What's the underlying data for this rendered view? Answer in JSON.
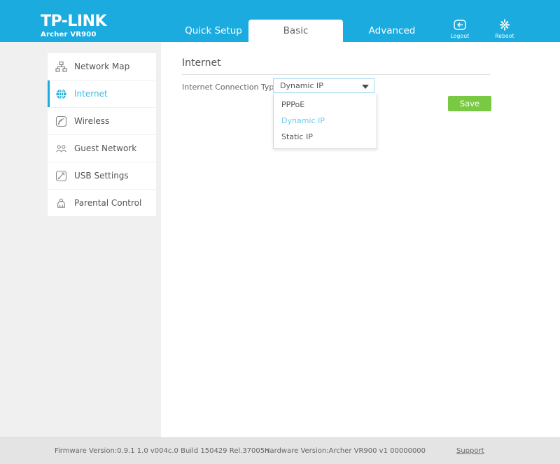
{
  "brand": {
    "name": "TP-LINK",
    "model": "Archer VR900"
  },
  "header": {
    "tabs": [
      {
        "label": "Quick Setup",
        "active": false
      },
      {
        "label": "Basic",
        "active": true
      },
      {
        "label": "Advanced",
        "active": false
      }
    ],
    "actions": [
      {
        "label": "Logout",
        "icon": "logout-icon"
      },
      {
        "label": "Reboot",
        "icon": "reboot-icon"
      }
    ],
    "accent_color": "#1cabdf"
  },
  "sidebar": {
    "items": [
      {
        "label": "Network Map",
        "icon": "network-map-icon",
        "active": false
      },
      {
        "label": "Internet",
        "icon": "globe-icon",
        "active": true
      },
      {
        "label": "Wireless",
        "icon": "wireless-signal-icon",
        "active": false
      },
      {
        "label": "Guest Network",
        "icon": "guest-network-icon",
        "active": false
      },
      {
        "label": "USB Settings",
        "icon": "usb-icon",
        "active": false
      },
      {
        "label": "Parental Control",
        "icon": "parental-control-icon",
        "active": false
      }
    ],
    "active_color": "#3fb8e6"
  },
  "main": {
    "section_title": "Internet",
    "connection_type": {
      "label": "Internet Connection Type:",
      "value": "Dynamic IP",
      "expanded": true,
      "options": [
        {
          "label": "PPPoE",
          "selected": false
        },
        {
          "label": "Dynamic IP",
          "selected": true
        },
        {
          "label": "Static IP",
          "selected": false
        }
      ]
    },
    "save_label": "Save",
    "save_color": "#7ac943"
  },
  "footer": {
    "firmware_version": "Firmware Version:0.9.1 1.0 v004c.0 Build 150429 Rel.37005n",
    "hardware_version": "Hardware Version:Archer VR900 v1 00000000",
    "support_label": "Support"
  }
}
